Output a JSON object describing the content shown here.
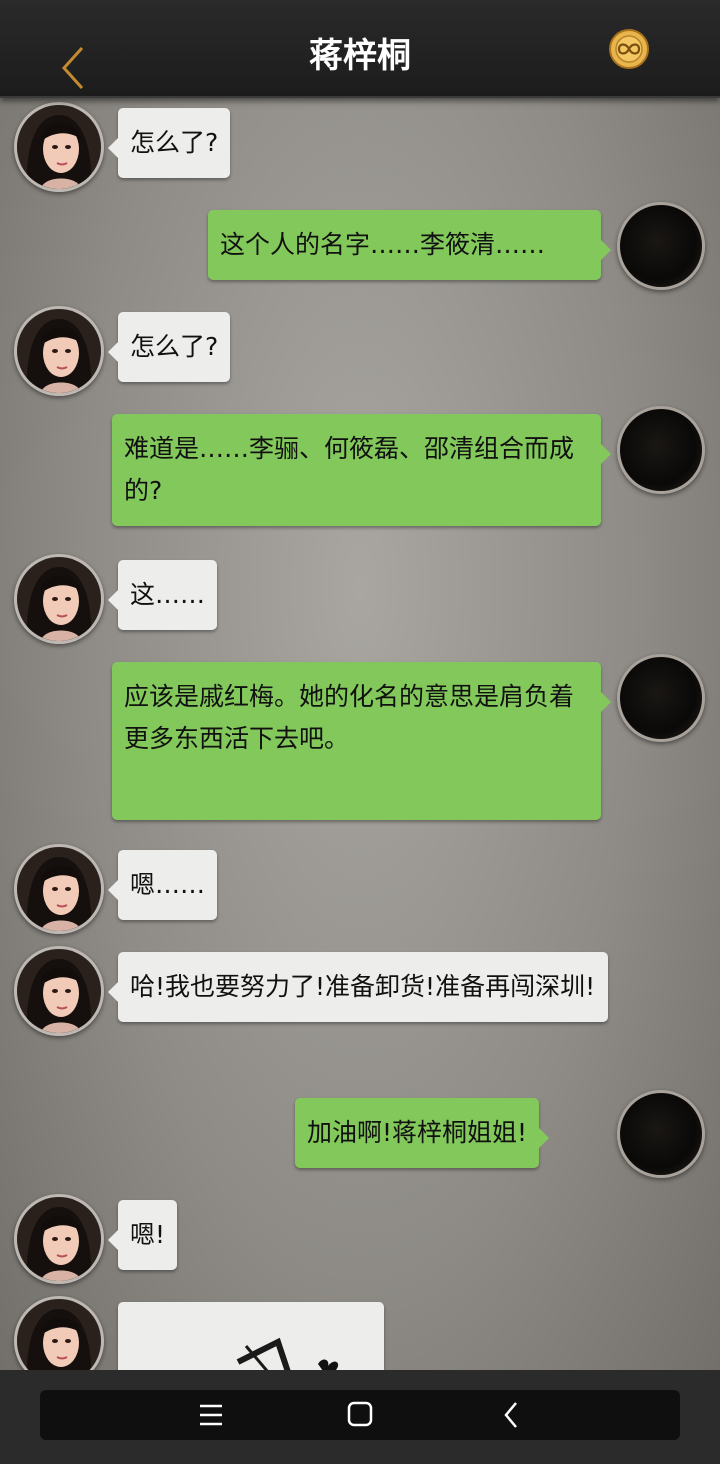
{
  "header": {
    "title": "蒋梓桐"
  },
  "messages": [
    {
      "side": "left",
      "text": "怎么了?"
    },
    {
      "side": "right",
      "text": "这个人的名字……李筱清……"
    },
    {
      "side": "left",
      "text": "怎么了?"
    },
    {
      "side": "right",
      "text": "难道是……李骊、何筱磊、邵清组合而成的?"
    },
    {
      "side": "left",
      "text": "这……"
    },
    {
      "side": "right",
      "text": "应该是戚红梅。她的化名的意思是肩负着更多东西活下去吧。"
    },
    {
      "side": "left",
      "text": "嗯……"
    },
    {
      "side": "left",
      "text": "哈!我也要努力了!准备卸货!准备再闯深圳!"
    },
    {
      "side": "right",
      "text": "加油啊!蒋梓桐姐姐!"
    },
    {
      "side": "left",
      "text": "嗯!"
    },
    {
      "side": "left",
      "type": "image"
    }
  ],
  "colors": {
    "header_bg": "#1c1c1c",
    "accent_gold": "#d9a441",
    "bubble_left": "#ededeb",
    "bubble_right": "#82c85a"
  },
  "icons": [
    "back-chevron-icon",
    "gold-coin-infinity-icon",
    "menu-icon",
    "home-icon",
    "back-icon"
  ]
}
